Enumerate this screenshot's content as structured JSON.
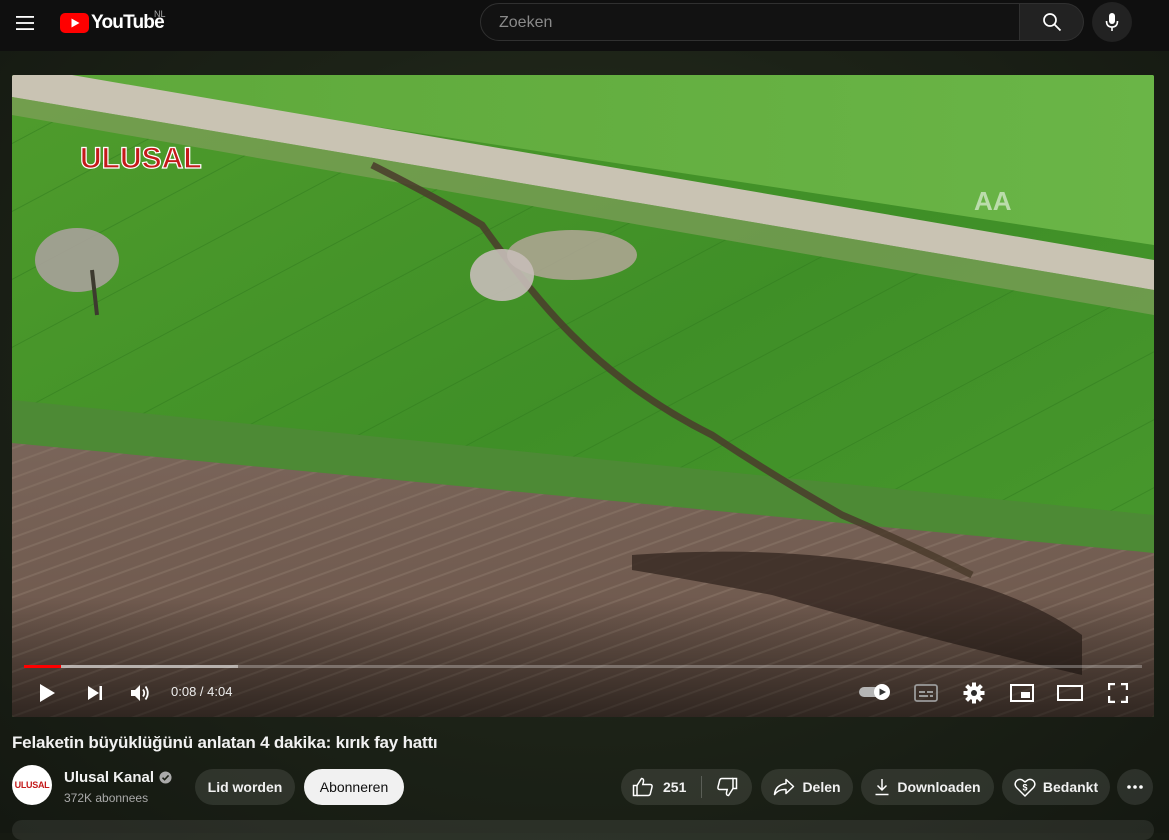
{
  "masthead": {
    "logo_text": "YouTube",
    "country_code": "NL",
    "search_placeholder": "Zoeken"
  },
  "video": {
    "overlay_logo": "ULUSAL",
    "watermark": "AA",
    "current_time": "0:08",
    "duration": "4:04",
    "time_text": "0:08 / 4:04",
    "progress_played_fraction": 0.033,
    "progress_buffered_fraction": 0.191,
    "autoplay": "on"
  },
  "title": "Felaketin büyüklüğünü anlatan 4 dakika: kırık fay hattı",
  "channel": {
    "name": "Ulusal Kanal",
    "avatar_text": "ULUSAL",
    "subscribers": "372K abonnees",
    "verified": true
  },
  "actions": {
    "join_label": "Lid worden",
    "subscribe_label": "Abonneren",
    "like_count": "251",
    "share_label": "Delen",
    "download_label": "Downloaden",
    "thanks_label": "Bedankt"
  },
  "colors": {
    "brand_red": "#FF0000",
    "background": "#0f0f0f",
    "progress": "#FF0000"
  },
  "icons": [
    "menu-icon",
    "youtube-logo-icon",
    "search-icon",
    "microphone-icon",
    "play-icon",
    "next-icon",
    "volume-icon",
    "autoplay-icon",
    "subtitles-icon",
    "settings-icon",
    "miniplayer-icon",
    "theater-icon",
    "fullscreen-icon",
    "verified-icon",
    "like-icon",
    "dislike-icon",
    "share-icon",
    "download-icon",
    "thanks-icon",
    "more-icon"
  ]
}
